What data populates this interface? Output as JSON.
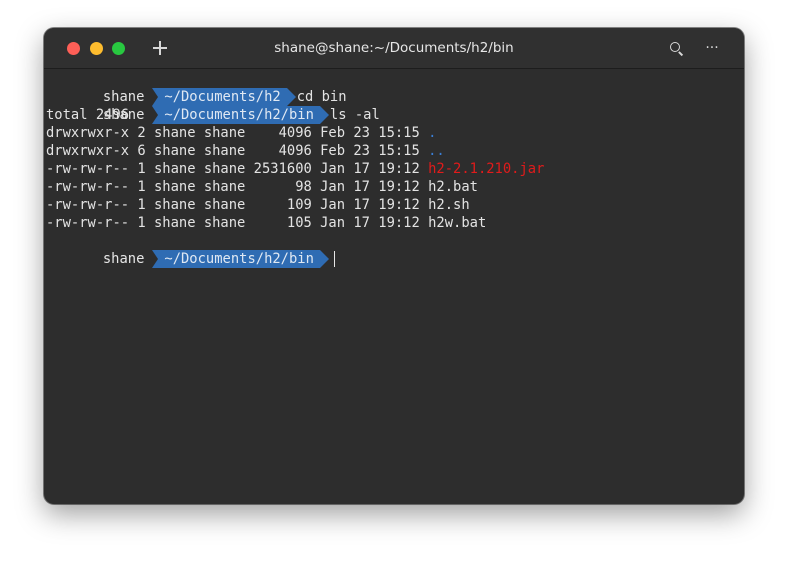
{
  "window": {
    "title": "shane@shane:~/Documents/h2/bin"
  },
  "titlebar": {
    "new_tab_icon": "plus-icon",
    "search_icon": "search-icon",
    "menu_icon": "more-icon",
    "menu_glyph": "···"
  },
  "colors": {
    "prompt_path_bg": "#2f6cb3",
    "dir_color": "#3b7fd6",
    "archive_color": "#e01b1b",
    "terminal_bg": "#2d2d2d",
    "text": "#e3e3e3"
  },
  "terminal": {
    "prompts": [
      {
        "user": "shane",
        "path": "~/Documents/h2",
        "command": "cd bin"
      },
      {
        "user": "shane",
        "path": "~/Documents/h2/bin",
        "command": "ls -al"
      },
      {
        "user": "shane",
        "path": "~/Documents/h2/bin",
        "command": ""
      }
    ],
    "total_line": "total 2496",
    "listing": [
      {
        "meta": "drwxrwxr-x 2 shane shane    4096 Feb 23 15:15 ",
        "name": ".",
        "kind": "dir"
      },
      {
        "meta": "drwxrwxr-x 6 shane shane    4096 Feb 23 15:15 ",
        "name": "..",
        "kind": "dir"
      },
      {
        "meta": "-rw-rw-r-- 1 shane shane 2531600 Jan 17 19:12 ",
        "name": "h2-2.1.210.jar",
        "kind": "archive"
      },
      {
        "meta": "-rw-rw-r-- 1 shane shane      98 Jan 17 19:12 ",
        "name": "h2.bat",
        "kind": "file"
      },
      {
        "meta": "-rw-rw-r-- 1 shane shane     109 Jan 17 19:12 ",
        "name": "h2.sh",
        "kind": "file"
      },
      {
        "meta": "-rw-rw-r-- 1 shane shane     105 Jan 17 19:12 ",
        "name": "h2w.bat",
        "kind": "file"
      }
    ]
  }
}
